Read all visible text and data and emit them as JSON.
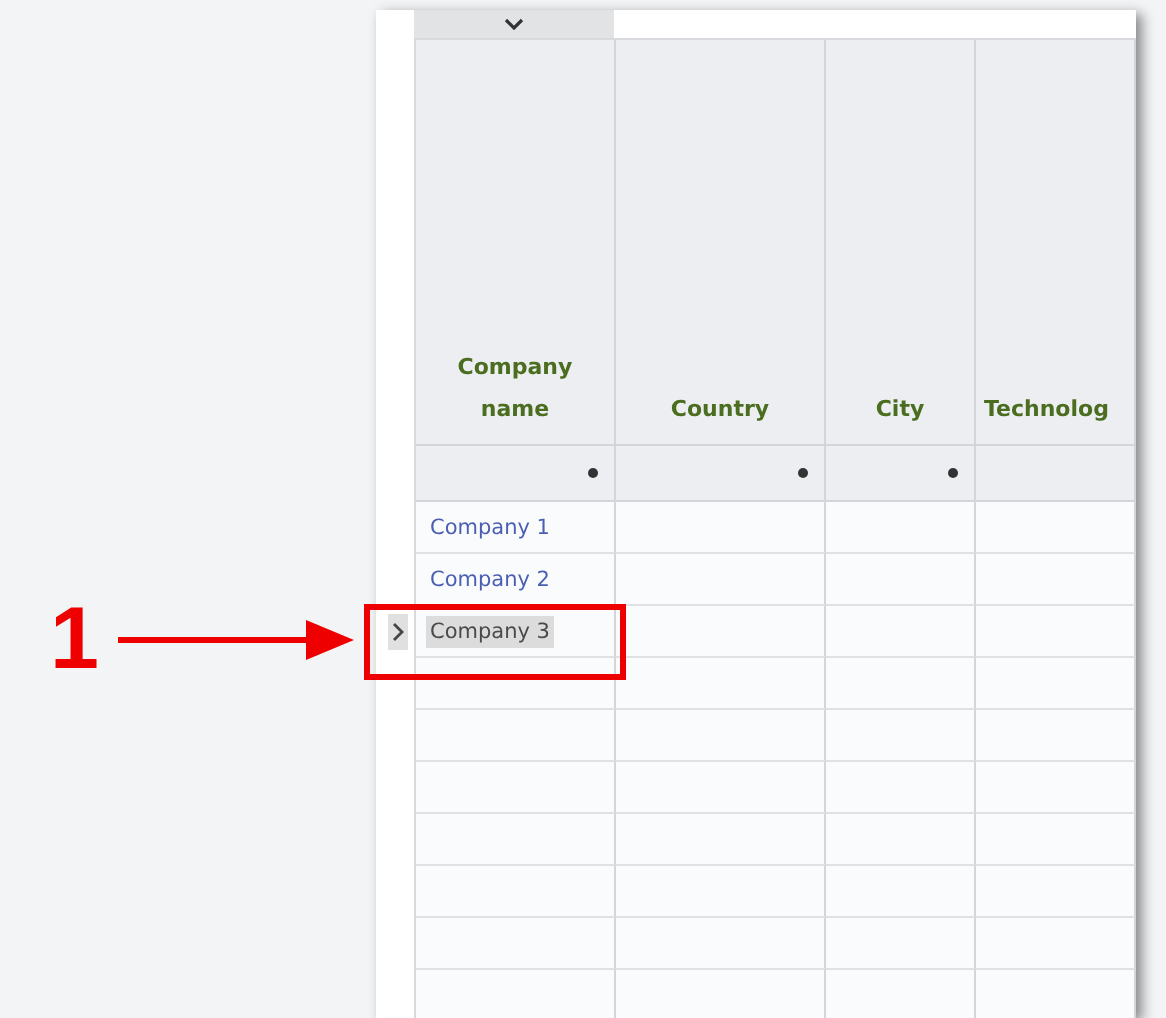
{
  "table": {
    "columns": [
      {
        "header": "Company name",
        "filter": true
      },
      {
        "header": "Country",
        "filter": true
      },
      {
        "header": "City",
        "filter": true
      },
      {
        "header": "Technolog",
        "filter": false
      }
    ],
    "rows": [
      {
        "cells": [
          "Company 1"
        ],
        "selected": false
      },
      {
        "cells": [
          "Company 2"
        ],
        "selected": false
      },
      {
        "cells": [
          "Company 3"
        ],
        "selected": true
      }
    ]
  },
  "callout": {
    "number": "1"
  }
}
